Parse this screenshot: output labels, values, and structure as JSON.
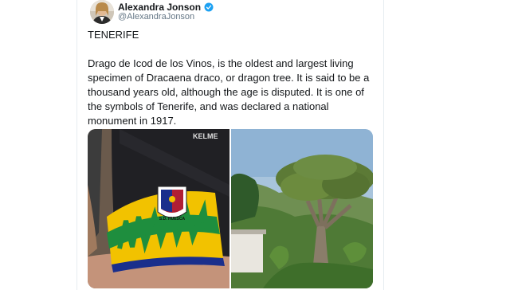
{
  "tweet": {
    "author": {
      "display_name": "Alexandra Jonson",
      "handle": "@AlexandraJonson",
      "verified_icon": "verified-badge-icon"
    },
    "title": "TENERIFE",
    "body": "Drago de Icod de los Vinos, is the oldest and largest living specimen of Dracaena draco, or dragon tree. It is said to be a thousand years old, although the age is disputed. It is one of the symbols of Tenerife, and was declared a national monument in 1917.",
    "media": {
      "photo_1": {
        "shirt_brand": "KELME",
        "crest_text": "S.D. HUESCA"
      },
      "photo_2": {}
    }
  },
  "colors": {
    "verified": "#1da1f2",
    "text": "#14171a",
    "muted": "#657786",
    "border": "#e6ecf0"
  }
}
